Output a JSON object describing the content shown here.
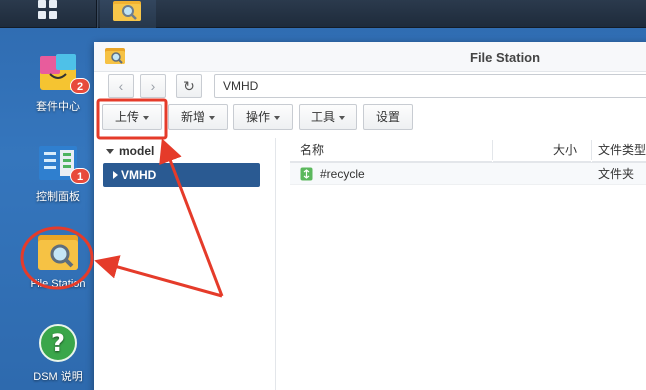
{
  "window": {
    "title": "File Station"
  },
  "desktop": {
    "icons": [
      {
        "label": "套件中心",
        "badge": "2"
      },
      {
        "label": "控制面板",
        "badge": "1"
      },
      {
        "label": "File Station"
      },
      {
        "label": "DSM 说明"
      }
    ]
  },
  "navbar": {
    "path": "VMHD"
  },
  "toolbar": {
    "buttons": [
      {
        "label": "上传"
      },
      {
        "label": "新增"
      },
      {
        "label": "操作"
      },
      {
        "label": "工具"
      },
      {
        "label": "设置"
      }
    ]
  },
  "tree": {
    "root": "model",
    "selected": "VMHD"
  },
  "file_list": {
    "columns": [
      "名称",
      "大小",
      "文件类型"
    ],
    "rows": [
      {
        "name": "#recycle",
        "size": "",
        "type": "文件夹"
      }
    ]
  },
  "colors": {
    "desktop_bg": "#3170b6",
    "accent_selected": "#2a5a92",
    "highlight_red": "#e53b2a"
  }
}
